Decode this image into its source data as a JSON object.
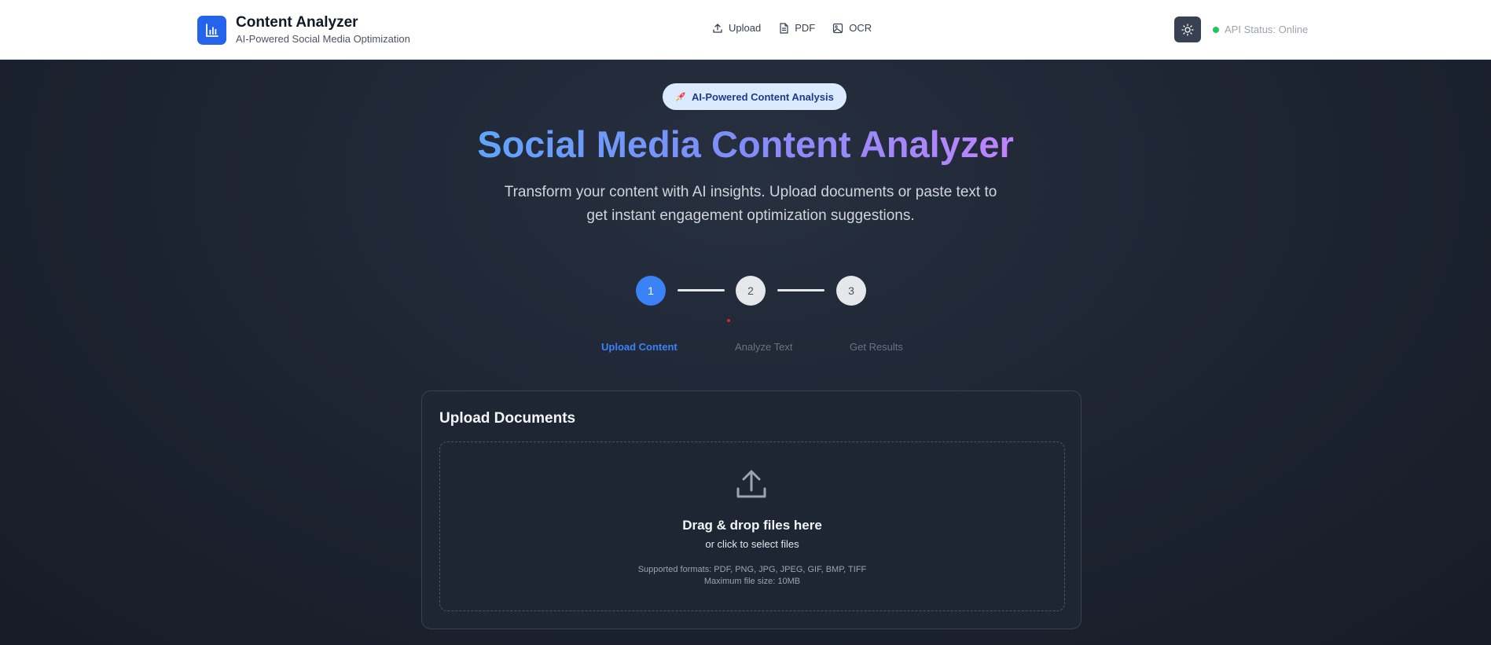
{
  "header": {
    "title": "Content Analyzer",
    "subtitle": "AI-Powered Social Media Optimization",
    "nav": [
      {
        "label": "Upload",
        "icon": "upload-icon"
      },
      {
        "label": "PDF",
        "icon": "document-icon"
      },
      {
        "label": "OCR",
        "icon": "image-icon"
      }
    ],
    "theme_toggle_icon": "sun-icon",
    "api_status": "API Status: Online",
    "api_status_color": "#22c55e"
  },
  "hero": {
    "badge": "AI-Powered Content Analysis",
    "badge_icon": "rocket-icon",
    "title": "Social Media Content Analyzer",
    "subtitle": "Transform your content with AI insights. Upload documents or paste text to get instant engagement optimization suggestions."
  },
  "stepper": {
    "current_step": 1,
    "steps": [
      {
        "number": "1",
        "label": "Upload Content"
      },
      {
        "number": "2",
        "label": "Analyze Text"
      },
      {
        "number": "3",
        "label": "Get Results"
      }
    ]
  },
  "upload": {
    "title": "Upload Documents",
    "drop_title": "Drag & drop files here",
    "drop_sub": "or click to select files",
    "formats": "Supported formats: PDF, PNG, JPG, JPEG, GIF, BMP, TIFF",
    "max_size": "Maximum file size: 10MB"
  },
  "colors": {
    "accent": "#3b82f6",
    "brand": "#2563eb",
    "background": "#1b2230"
  }
}
